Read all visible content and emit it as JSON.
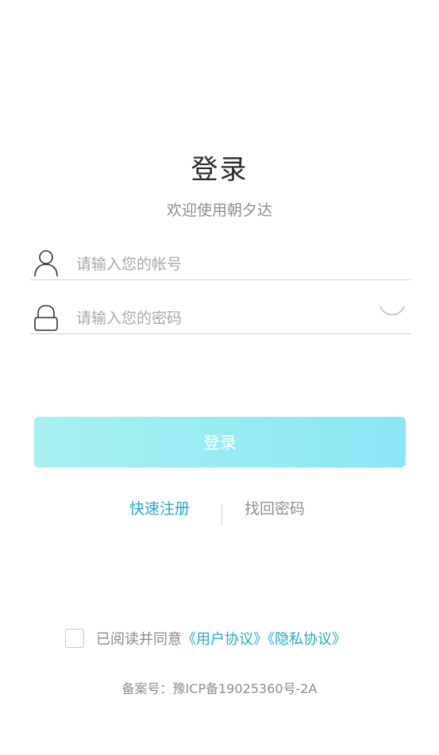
{
  "header": {
    "title": "登录",
    "subtitle": "欢迎使用朝夕达"
  },
  "form": {
    "account": {
      "placeholder": "请输入您的帐号",
      "value": "",
      "icon": "user-icon"
    },
    "password": {
      "placeholder": "请输入您的密码",
      "value": "",
      "icon": "lock-icon",
      "toggle_icon": "eye-closed-icon"
    },
    "login_label": "登录"
  },
  "links": {
    "register": "快速注册",
    "forgot": "找回密码"
  },
  "agreement": {
    "prefix": "已阅读并同意",
    "user_protocol": "《用户协议》",
    "privacy_protocol": "《隐私协议》",
    "checked": false
  },
  "footer": {
    "icp": "备案号：豫ICP备19025360号-2A"
  },
  "colors": {
    "accent": "#27a9c4",
    "button_gradient_start": "#a8f0f2",
    "button_gradient_end": "#8ae6f4",
    "muted_text": "#8c8c8c"
  }
}
